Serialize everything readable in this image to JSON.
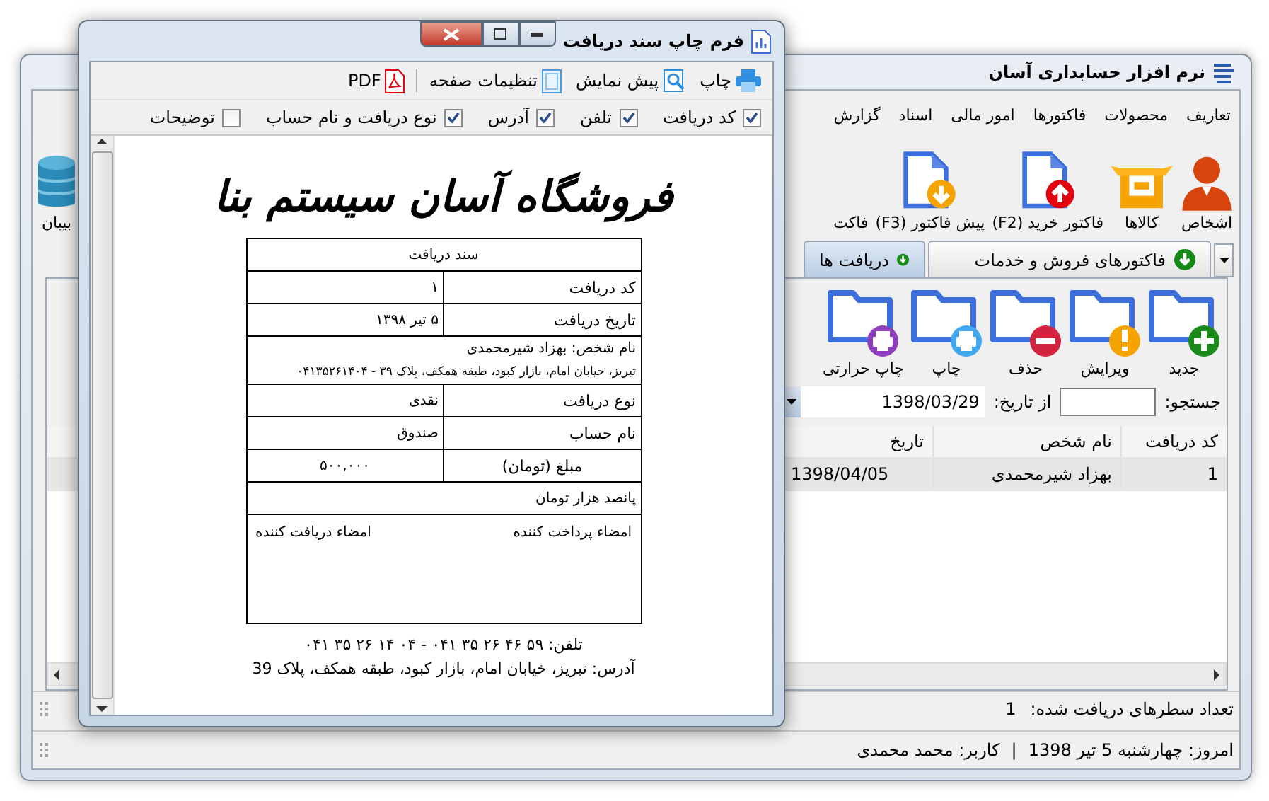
{
  "main_window": {
    "title": "نرم افزار حسابداری آسان",
    "menu": [
      {
        "label": "تعاریف"
      },
      {
        "label": "محصولات"
      },
      {
        "label": "فاکتورها"
      },
      {
        "label": "امور مالی"
      },
      {
        "label": "اسناد"
      },
      {
        "label": "گزارش"
      }
    ],
    "ribbon": [
      {
        "label": "اشخاص",
        "kind": "person"
      },
      {
        "label": "کالاها",
        "kind": "box"
      },
      {
        "label": "فاکتور خرید (F2)",
        "kind": "doc-up"
      },
      {
        "label": "پیش فاکتور (F3)",
        "kind": "doc-down"
      },
      {
        "label": "فاکت",
        "kind": "none"
      }
    ],
    "side_item": {
      "label": "بیبان",
      "kind": "database"
    },
    "tabs": [
      {
        "label": "فاکتورهای فروش و خدمات",
        "selected": false
      },
      {
        "label": "دریافت ها",
        "selected": true
      }
    ],
    "actions": [
      {
        "label": "جدید",
        "kind": "plus",
        "color": "#1a8a1a"
      },
      {
        "label": "ویرایش",
        "kind": "alert",
        "color": "#f5a300"
      },
      {
        "label": "حذف",
        "kind": "minus",
        "color": "#d3243f"
      },
      {
        "label": "چاپ",
        "kind": "print",
        "color": "#42a9f0"
      },
      {
        "label": "چاپ حرارتی",
        "kind": "print",
        "color": "#8e3dbd"
      }
    ],
    "search": {
      "label": "جستجو:",
      "from_label": "از تاریخ:",
      "from_value": "1398/03/29"
    },
    "table": {
      "columns": [
        "کد دریافت",
        "نام شخص",
        "تاریخ"
      ],
      "rows": [
        {
          "cells": [
            "1",
            "بهزاد شیرمحمدی",
            "1398/04/05"
          ],
          "selected": true
        }
      ]
    },
    "status": {
      "label": "تعداد سطرهای دریافت شده:",
      "count": "1"
    },
    "footer": {
      "today": "امروز: چهارشنبه 5 تیر 1398",
      "separator": "|",
      "user": "کاربر: محمد محمدی"
    }
  },
  "dialog": {
    "title": "فرم چاپ سند دریافت",
    "toolbar": [
      {
        "label": "چاپ",
        "kind": "print"
      },
      {
        "label": "پیش نمایش",
        "kind": "preview"
      },
      {
        "label": "تنظیمات صفحه",
        "kind": "page"
      },
      {
        "label": "PDF",
        "kind": "pdf"
      }
    ],
    "options": [
      {
        "label": "کد دریافت",
        "checked": true
      },
      {
        "label": "تلفن",
        "checked": true
      },
      {
        "label": "آدرس",
        "checked": true
      },
      {
        "label": "نوع دریافت و نام حساب",
        "checked": true
      },
      {
        "label": "توضیحات",
        "checked": false
      }
    ],
    "document": {
      "store_name": "فروشگاه آسان سیستم بنا",
      "heading": "سند دریافت",
      "rows": [
        {
          "label": "کد دریافت",
          "value": "۱"
        },
        {
          "label": "تاریخ دریافت",
          "value": "۵ تیر ۱۳۹۸"
        }
      ],
      "person": "نام شخص: بهزاد شیرمحمدی",
      "person_address": "تبریز، خیابان امام، بازار کبود، طبقه همکف، پلاک ۳۹ - ۰۴۱۳۵۲۶۱۴۰۴",
      "rows_2": [
        {
          "label": "نوع دریافت",
          "value": "نقدی"
        },
        {
          "label": "نام حساب",
          "value": "صندوق"
        }
      ],
      "amount_label": "مبلغ (تومان)",
      "amount": "۵۰۰,۰۰۰",
      "amount_words": "پانصد هزار تومان",
      "payer_sign": "امضاء پرداخت کننده",
      "receiver_sign": "امضاء دریافت کننده",
      "phone": "تلفن: ۵۹ ۴۶ ۲۶ ۳۵ ۰۴۱ - ۰۴ ۱۴ ۲۶ ۳۵ ۰۴۱",
      "address": "آدرس: تبریز، خیابان امام، بازار کبود، طبقه همکف، پلاک 39"
    }
  }
}
